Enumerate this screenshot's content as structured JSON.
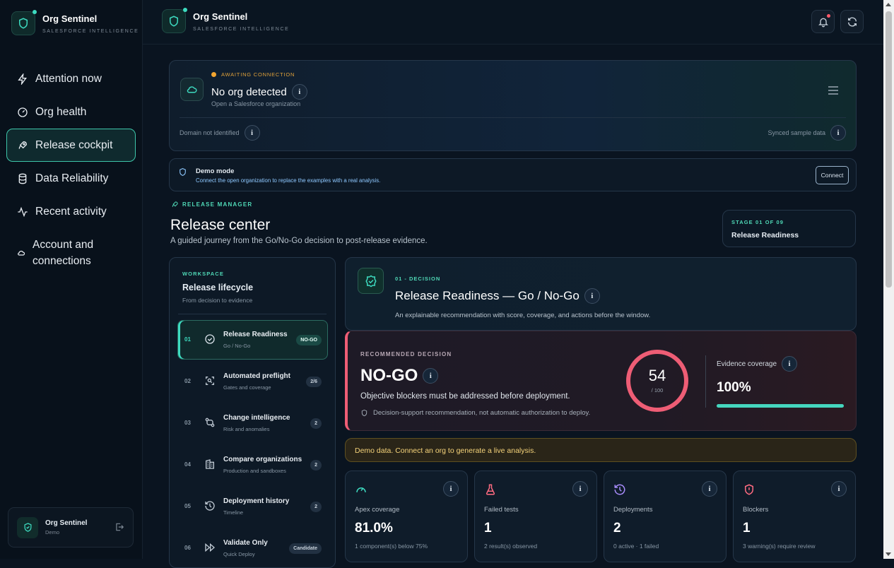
{
  "app": {
    "name": "Org Sentinel",
    "tagline": "SALESFORCE INTELLIGENCE"
  },
  "sidebar": {
    "items": [
      {
        "label": "Attention now",
        "icon": "bolt-icon"
      },
      {
        "label": "Org health",
        "icon": "gauge-icon"
      },
      {
        "label": "Release cockpit",
        "icon": "rocket-icon",
        "active": true
      },
      {
        "label": "Data Reliability",
        "icon": "database-icon"
      },
      {
        "label": "Recent activity",
        "icon": "activity-icon"
      },
      {
        "label": "Account and connections",
        "icon": "cloud-icon"
      }
    ],
    "user": {
      "name": "Org Sentinel",
      "mode": "Demo"
    }
  },
  "connection": {
    "status": "AWAITING CONNECTION",
    "title": "No org detected",
    "subtitle": "Open a Salesforce organization",
    "domain": "Domain not identified",
    "sync": "Synced sample data"
  },
  "demo": {
    "title": "Demo mode",
    "text": "Connect the open organization to replace the examples with a real analysis.",
    "button": "Connect"
  },
  "release": {
    "eyebrow": "RELEASE MANAGER",
    "title": "Release center",
    "subtitle": "A guided journey from the Go/No-Go decision to post-release evidence.",
    "stage_label": "STAGE 01 OF 09",
    "stage_name": "Release Readiness"
  },
  "workspace": {
    "eyebrow": "WORKSPACE",
    "title": "Release lifecycle",
    "subtitle": "From decision to evidence",
    "steps": [
      {
        "num": "01",
        "title": "Release Readiness",
        "sub": "Go / No-Go",
        "badge": "NO-GO",
        "icon": "check-circle-icon"
      },
      {
        "num": "02",
        "title": "Automated preflight",
        "sub": "Gates and coverage",
        "badge": "2/6",
        "icon": "scan-icon"
      },
      {
        "num": "03",
        "title": "Change intelligence",
        "sub": "Risk and anomalies",
        "badge": "2",
        "icon": "git-compare-icon"
      },
      {
        "num": "04",
        "title": "Compare organizations",
        "sub": "Production and sandboxes",
        "badge": "2",
        "icon": "building-icon"
      },
      {
        "num": "05",
        "title": "Deployment history",
        "sub": "Timeline",
        "badge": "2",
        "icon": "history-icon"
      },
      {
        "num": "06",
        "title": "Validate Only",
        "sub": "Quick Deploy",
        "badge": "Candidate",
        "icon": "fast-forward-icon"
      }
    ]
  },
  "decision": {
    "eyebrow": "01 - DECISION",
    "title": "Release Readiness — Go / No-Go",
    "subtitle": "An explainable recommendation with score, coverage, and actions before the window."
  },
  "recommendation": {
    "eyebrow": "RECOMMENDED DECISION",
    "verdict": "NO-GO",
    "reason": "Objective blockers must be addressed before deployment.",
    "note": "Decision-support recommendation, not automatic authorization to deploy.",
    "score": "54",
    "score_max": "/ 100",
    "score_value": 54,
    "evidence_label": "Evidence coverage",
    "evidence_value": "100%",
    "evidence_fraction": 1.0,
    "accent": "#ee5d75"
  },
  "warning": "Demo data. Connect an org to generate a live analysis.",
  "stats": [
    {
      "label": "Apex coverage",
      "value": "81.0%",
      "detail": "1 component(s) below 75%",
      "icon": "gauge-icon",
      "color": "#3ddbc0"
    },
    {
      "label": "Failed tests",
      "value": "1",
      "detail": "2 result(s) observed",
      "icon": "flask-icon",
      "color": "#ff6b81"
    },
    {
      "label": "Deployments",
      "value": "2",
      "detail": "0 active · 1 failed",
      "icon": "history-icon",
      "color": "#a78bfa"
    },
    {
      "label": "Blockers",
      "value": "1",
      "detail": "3 warning(s) require review",
      "icon": "shield-alert-icon",
      "color": "#ff6b81"
    }
  ]
}
